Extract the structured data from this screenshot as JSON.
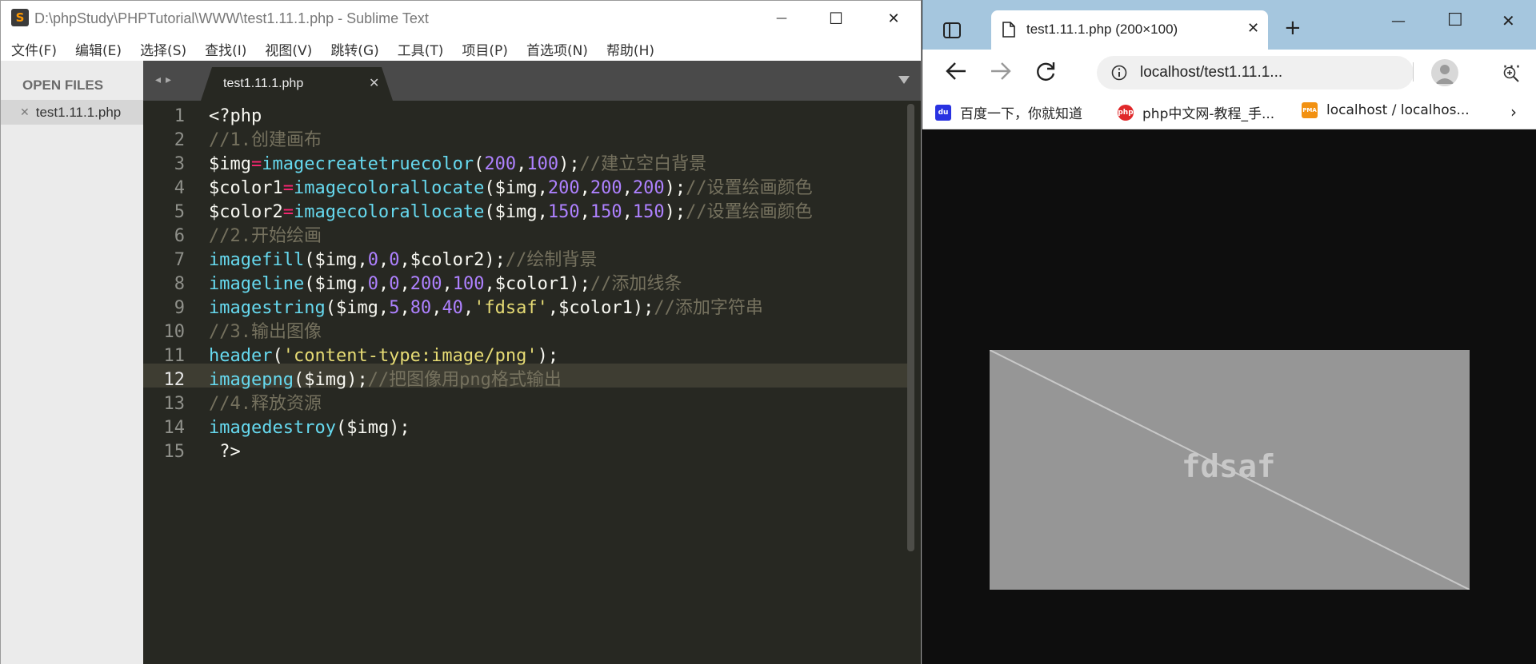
{
  "sublime": {
    "title": "D:\\phpStudy\\PHPTutorial\\WWW\\test1.11.1.php - Sublime Text",
    "logo_letter": "S",
    "menu": [
      "文件(F)",
      "编辑(E)",
      "选择(S)",
      "查找(I)",
      "视图(V)",
      "跳转(G)",
      "工具(T)",
      "项目(P)",
      "首选项(N)",
      "帮助(H)"
    ],
    "sidebar": {
      "heading": "OPEN FILES",
      "file": "test1.11.1.php",
      "close_glyph": "✕"
    },
    "tab": {
      "label": "test1.11.1.php",
      "close_glyph": "✕"
    },
    "nav_arrows": "◂▸",
    "current_line": 12,
    "line_numbers": [
      "1",
      "2",
      "3",
      "4",
      "5",
      "6",
      "7",
      "8",
      "9",
      "10",
      "11",
      "12",
      "13",
      "14",
      "15"
    ],
    "code_lines": [
      [
        [
          "w",
          "<?php"
        ]
      ],
      [
        [
          "c",
          "//1.创建画布"
        ]
      ],
      [
        [
          "w",
          "$img"
        ],
        [
          "o",
          "="
        ],
        [
          "f",
          "imagecreatetruecolor"
        ],
        [
          "w",
          "("
        ],
        [
          "n",
          "200"
        ],
        [
          "w",
          ","
        ],
        [
          "n",
          "100"
        ],
        [
          "w",
          ");"
        ],
        [
          "c",
          "//建立空白背景"
        ]
      ],
      [
        [
          "w",
          "$color1"
        ],
        [
          "o",
          "="
        ],
        [
          "f",
          "imagecolorallocate"
        ],
        [
          "w",
          "($img,"
        ],
        [
          "n",
          "200"
        ],
        [
          "w",
          ","
        ],
        [
          "n",
          "200"
        ],
        [
          "w",
          ","
        ],
        [
          "n",
          "200"
        ],
        [
          "w",
          ");"
        ],
        [
          "c",
          "//设置绘画颜色"
        ]
      ],
      [
        [
          "w",
          "$color2"
        ],
        [
          "o",
          "="
        ],
        [
          "f",
          "imagecolorallocate"
        ],
        [
          "w",
          "($img,"
        ],
        [
          "n",
          "150"
        ],
        [
          "w",
          ","
        ],
        [
          "n",
          "150"
        ],
        [
          "w",
          ","
        ],
        [
          "n",
          "150"
        ],
        [
          "w",
          ");"
        ],
        [
          "c",
          "//设置绘画颜色"
        ]
      ],
      [
        [
          "c",
          "//2.开始绘画"
        ]
      ],
      [
        [
          "f",
          "imagefill"
        ],
        [
          "w",
          "($img,"
        ],
        [
          "n",
          "0"
        ],
        [
          "w",
          ","
        ],
        [
          "n",
          "0"
        ],
        [
          "w",
          ",$color2);"
        ],
        [
          "c",
          "//绘制背景"
        ]
      ],
      [
        [
          "f",
          "imageline"
        ],
        [
          "w",
          "($img,"
        ],
        [
          "n",
          "0"
        ],
        [
          "w",
          ","
        ],
        [
          "n",
          "0"
        ],
        [
          "w",
          ","
        ],
        [
          "n",
          "200"
        ],
        [
          "w",
          ","
        ],
        [
          "n",
          "100"
        ],
        [
          "w",
          ",$color1);"
        ],
        [
          "c",
          "//添加线条"
        ]
      ],
      [
        [
          "f",
          "imagestring"
        ],
        [
          "w",
          "($img,"
        ],
        [
          "n",
          "5"
        ],
        [
          "w",
          ","
        ],
        [
          "n",
          "80"
        ],
        [
          "w",
          ","
        ],
        [
          "n",
          "40"
        ],
        [
          "w",
          ","
        ],
        [
          "s",
          "'fdsaf'"
        ],
        [
          "w",
          ",$color1);"
        ],
        [
          "c",
          "//添加字符串"
        ]
      ],
      [
        [
          "c",
          "//3.输出图像"
        ]
      ],
      [
        [
          "f",
          "header"
        ],
        [
          "w",
          "("
        ],
        [
          "s",
          "'content-type:image/png'"
        ],
        [
          "w",
          ");"
        ]
      ],
      [
        [
          "f",
          "imagepng"
        ],
        [
          "w",
          "($img);"
        ],
        [
          "c",
          "//把图像用png格式输出"
        ]
      ],
      [
        [
          "c",
          "//4.释放资源"
        ]
      ],
      [
        [
          "f",
          "imagedestroy"
        ],
        [
          "w",
          "($img);"
        ]
      ],
      [
        [
          "w",
          " ?>"
        ]
      ]
    ],
    "window_buttons": {
      "minimize": "—",
      "maximize": "☐",
      "close": "✕"
    }
  },
  "browser": {
    "tab_title": "test1.11.1.php (200×100)",
    "tab_close": "✕",
    "new_tab": "+",
    "address": "localhost/test1.11.1...",
    "bookmarks": [
      {
        "label": "百度一下，你就知道",
        "icon": "baidu-icon",
        "color": "#2932e1",
        "glyph": "du"
      },
      {
        "label": "php中文网-教程_手...",
        "icon": "php-cn-icon",
        "color": "#e0282a",
        "glyph": "php"
      },
      {
        "label": "localhost / localhos...",
        "icon": "phpmyadmin-icon",
        "color": "#f29111",
        "glyph": "PMA"
      }
    ],
    "bookmarks_more": "›",
    "more_glyph": "···",
    "window_buttons": {
      "minimize": "—",
      "maximize": "☐",
      "close": "✕"
    },
    "image": {
      "text": "fdsaf",
      "background": "#969696",
      "line_color": "#c8c8c8",
      "width": 200,
      "height": 100
    }
  }
}
